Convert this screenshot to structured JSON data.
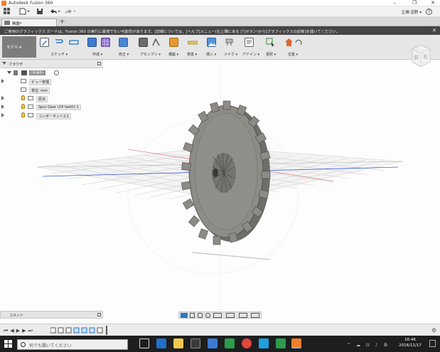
{
  "window": {
    "title": "Autodesk Fusion 360"
  },
  "titlebar": {
    "minimize": "–",
    "maximize": "❐",
    "close": "✕"
  },
  "qat": {
    "user": "正橋 道野 ▾",
    "help": "?"
  },
  "tabs": [
    {
      "label": "無題*"
    }
  ],
  "notice": {
    "text": "ご使用のグラフィックス カードは、Fusion 360 の実行に最適でない可能性があります。[詳細については、[ヘルプ]メニュー(右上隅にある [?]ボタン)から[グラフィックスの診断]を開いてください。",
    "close": "✕"
  },
  "ribbon": {
    "workspace": "モデル ▾",
    "groups": [
      {
        "label": "スケッチ ▾"
      },
      {
        "label": "作成 ▾"
      },
      {
        "label": "修正 ▾"
      },
      {
        "label": "アセンブリ ▾"
      },
      {
        "label": "構築 ▾"
      },
      {
        "label": "検査 ▾"
      },
      {
        "label": "挿入 ▾"
      },
      {
        "label": "メイク ▾"
      },
      {
        "label": "アドイン ▾"
      },
      {
        "label": "選択 ▾"
      },
      {
        "label": "位置 ▾"
      }
    ]
  },
  "viewcube": {
    "front": "前",
    "right": "右"
  },
  "browser": {
    "title": "ブラウザ",
    "root": "(未保存)",
    "items": [
      {
        "label": "ビュー管理"
      },
      {
        "label": "単位: mm"
      },
      {
        "label": "原点"
      },
      {
        "label": "Spur Gear (24 teeth) 1"
      },
      {
        "label": "コンポーネント2:1"
      }
    ]
  },
  "comment": {
    "label": "コメント"
  },
  "clock": {
    "time": "16:46",
    "date": "2016/11/17"
  },
  "taskbar": {
    "search_placeholder": "何でも聞いてください"
  },
  "colors": {
    "notice_bg": "#454545",
    "accent": "#2a78c4",
    "grid": "#c8c8c8",
    "gear": "#8d8b86"
  }
}
